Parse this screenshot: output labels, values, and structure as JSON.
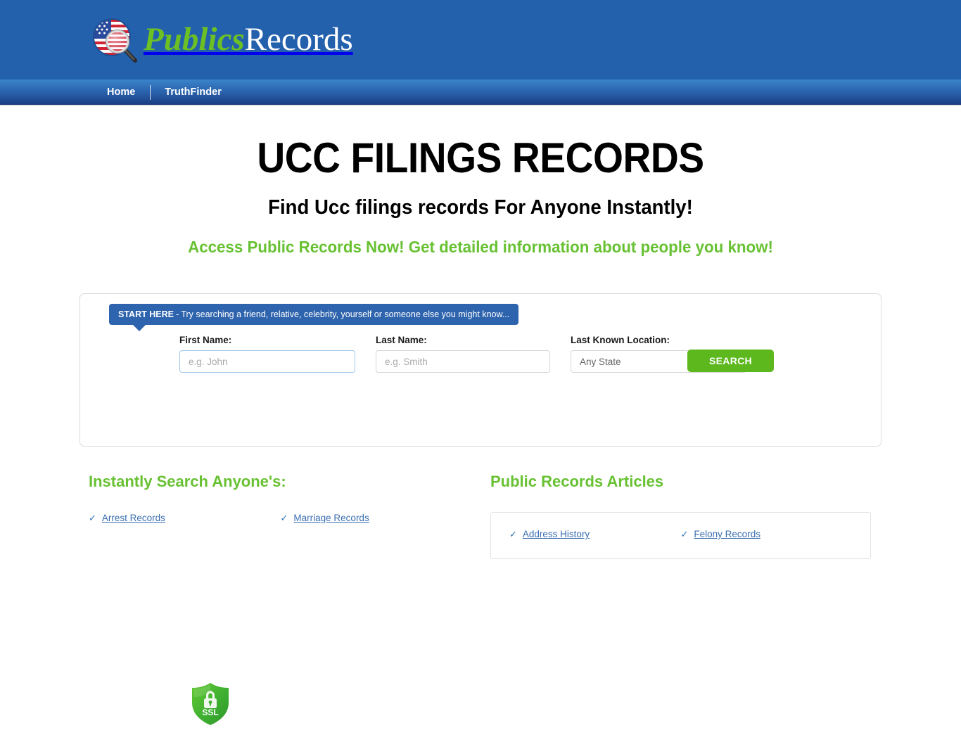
{
  "header": {
    "logo": {
      "icon": "us-flag-magnifier-icon",
      "word1": "Publics",
      "word2": "Records"
    }
  },
  "nav": {
    "items": [
      {
        "label": "Home"
      },
      {
        "label": "TruthFinder"
      }
    ]
  },
  "hero": {
    "title": "UCC FILINGS RECORDS",
    "subtitle": "Find Ucc filings records For Anyone Instantly!",
    "tagline": "Access Public Records Now! Get detailed information about people you know!"
  },
  "search": {
    "tooltip_bold": "START HERE",
    "tooltip_rest": "- Try searching a friend, relative, celebrity, yourself or someone else you might know...",
    "first_name_label": "First Name:",
    "first_name_placeholder": "e.g. John",
    "first_name_value": "",
    "last_name_label": "Last Name:",
    "last_name_placeholder": "e.g. Smith",
    "last_name_value": "",
    "location_label": "Last Known Location:",
    "location_selected": "Any State",
    "submit_label": "SEARCH",
    "ssl_badge_text": "SSL"
  },
  "left_column": {
    "heading": "Instantly Search Anyone's:",
    "links": [
      {
        "label": "Arrest Records"
      },
      {
        "label": "Marriage Records"
      }
    ]
  },
  "right_column": {
    "heading": "Public Records Articles",
    "links": [
      {
        "label": "Address History"
      },
      {
        "label": "Felony Records"
      }
    ]
  },
  "colors": {
    "header_blue": "#2461ad",
    "nav_blue_top": "#3b84cb",
    "nav_blue_bottom": "#16357a",
    "brand_green": "#67c132",
    "button_green": "#5cb81d",
    "link_blue": "#3a6fb0"
  }
}
